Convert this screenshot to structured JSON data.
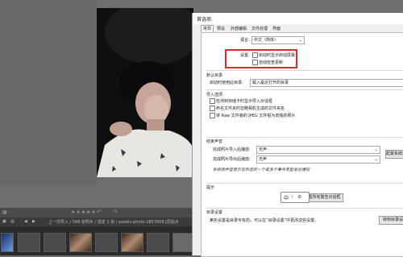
{
  "filmstrip": {
    "toolbar_stars": "★★★★★",
    "info_text": "上一次导入 / 598 张照片 / 选定 1 张 / pexels-photo-1857008 [原始大"
  },
  "dialog": {
    "title": "首选项",
    "tabs": [
      "常规",
      "预设",
      "外部编辑",
      "文件处理",
      "界面"
    ],
    "general": {
      "language_label": "语言:",
      "language_value": "中文（简体）",
      "setting_label": "设置:",
      "startup_splash": "启动时显示启动屏幕",
      "auto_update": "自动检查更新",
      "default_catalog_section": "默认目录",
      "default_catalog_label": "启动时使用此目录:",
      "default_catalog_value": "载入最近打开的目录",
      "import_section": "导入选项",
      "import_options": [
        "检测到存储卡时显示导入对话框",
        "命名文件夹时忽略相机生成的文件夹名",
        "将 Raw 文件旁的 JPEG 文件视为单独的照片"
      ],
      "sound_section": "结束声音",
      "sound_import_label": "完成照片导入后播放:",
      "sound_import_value": "无声",
      "sound_export_label": "完成照片导出后播放:",
      "sound_export_value": "无声",
      "sound_system_button": "配置系统声音",
      "sound_note": "系统将声音显示在所选的一个或多个事件类型发出通知",
      "tips_section": "提示",
      "tips_button": "重置所有警告对话框",
      "catalog_section": "目录设置",
      "catalog_note": "某些设置是目录专有的，可以在“目录设置”中更改这些设置。",
      "catalog_button": "转到目录设置"
    }
  },
  "ime": {
    "char": "中"
  }
}
